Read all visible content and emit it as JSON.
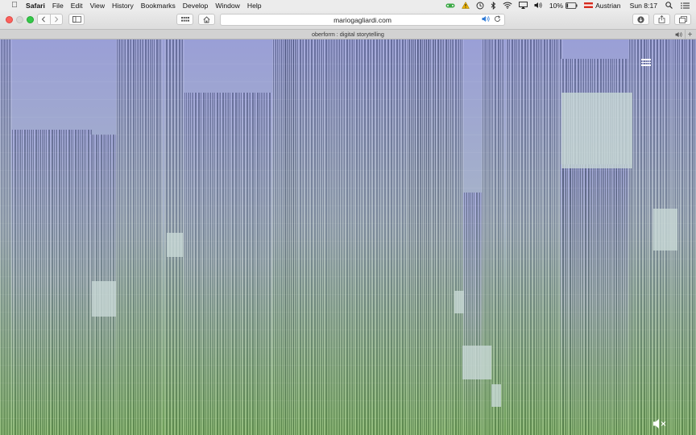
{
  "menubar": {
    "app_name": "Safari",
    "menus": [
      "File",
      "Edit",
      "View",
      "History",
      "Bookmarks",
      "Develop",
      "Window",
      "Help"
    ],
    "battery_percent": "10%",
    "input_source": "Austrian",
    "clock": "Sun 8:17"
  },
  "browser": {
    "url": "mariogagliardi.com",
    "tab_title": "oberform : digital storytelling"
  },
  "colors": {
    "sky_top": "#9a9fd6",
    "ground_bottom": "#6e9e58"
  },
  "icons": {
    "menu": "hamburger-icon",
    "sound": "speaker-muted-icon"
  }
}
